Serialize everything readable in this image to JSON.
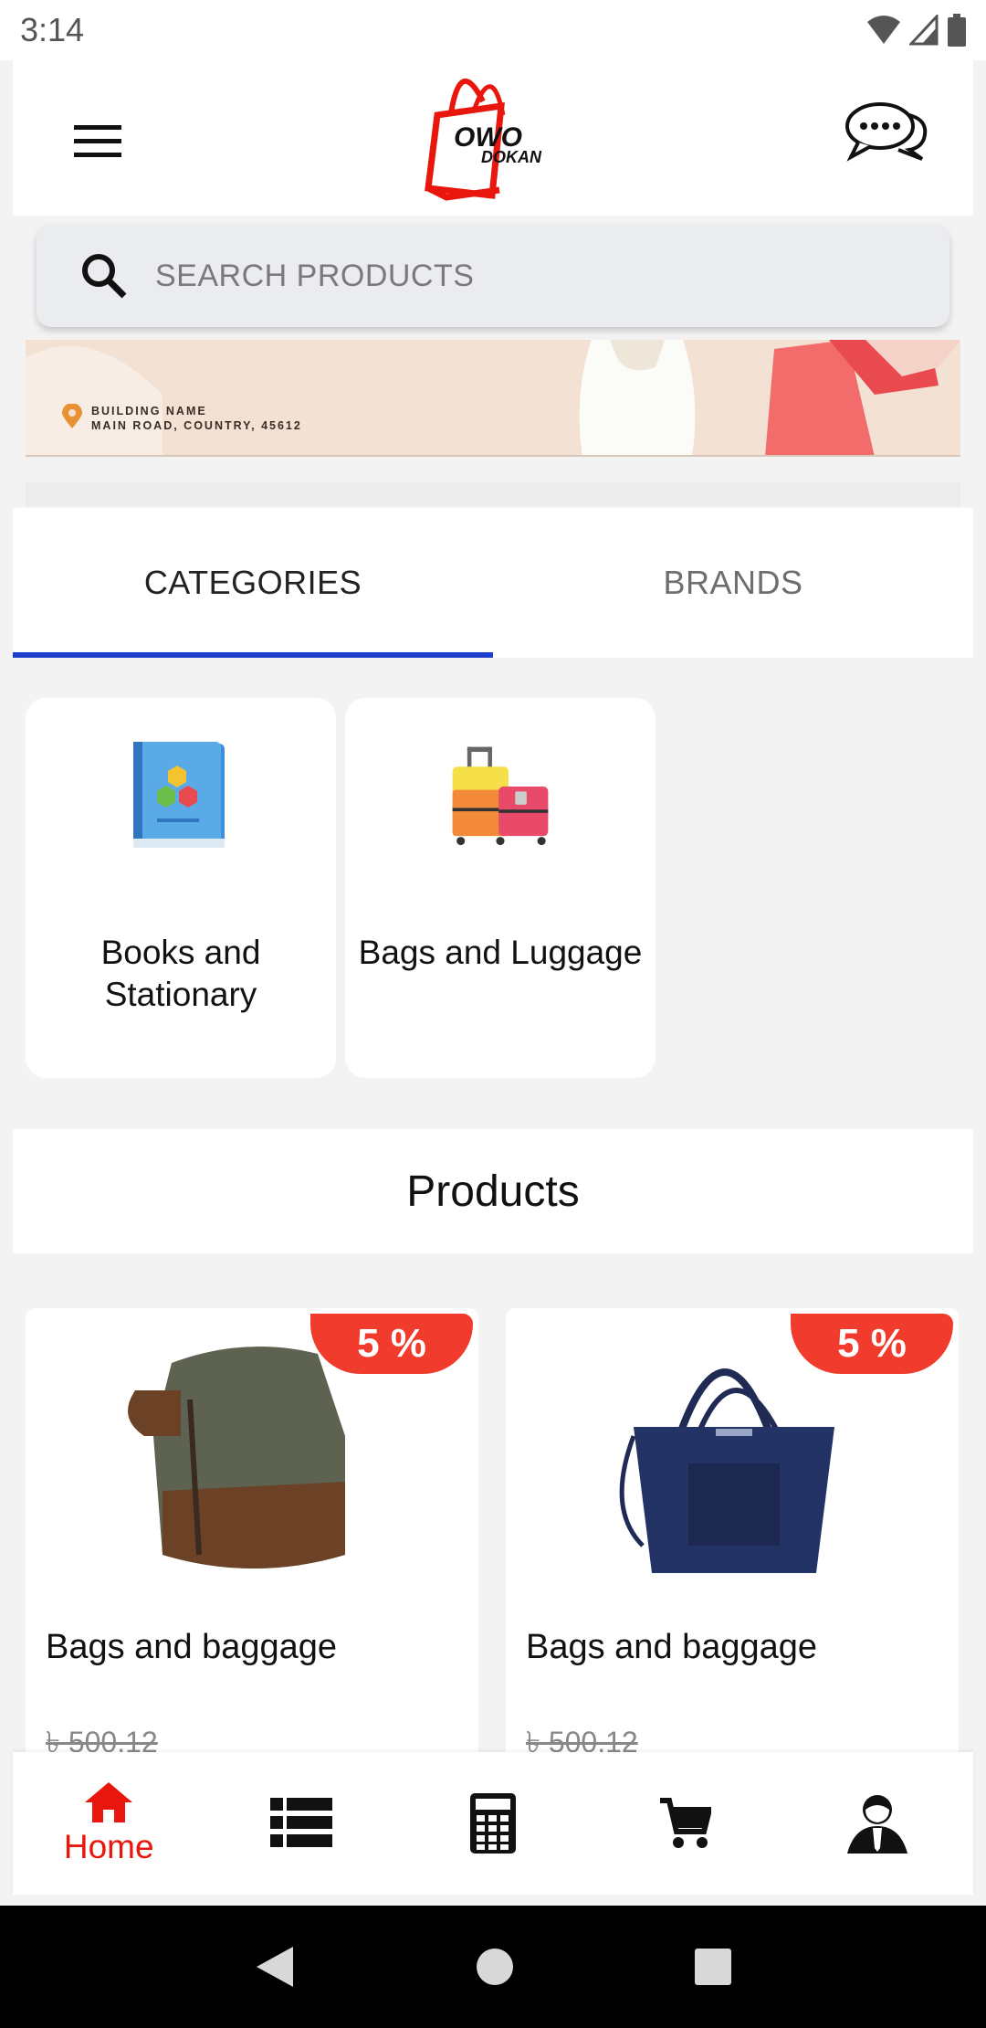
{
  "status_bar": {
    "time": "3:14"
  },
  "header": {
    "logo_line1": "OWO",
    "logo_line2": "DOKAN",
    "menu_icon": "menu-icon",
    "chat_icon": "chat-icon"
  },
  "search": {
    "placeholder": "SEARCH PRODUCTS"
  },
  "banner": {
    "address_line1": "BUILDING NAME",
    "address_line2": "MAIN ROAD, COUNTRY, 45612"
  },
  "tabs": [
    {
      "label": "CATEGORIES",
      "active": true
    },
    {
      "label": "BRANDS",
      "active": false
    }
  ],
  "categories": [
    {
      "label": "Books and Stationary",
      "icon": "book-icon"
    },
    {
      "label": "Bags and Luggage",
      "icon": "luggage-icon"
    }
  ],
  "products_section": {
    "title": "Products"
  },
  "products": [
    {
      "name": "Bags and baggage",
      "discount": "5 %",
      "price": "৳ 500.12",
      "image": "toiletry-bag-image"
    },
    {
      "name": "Bags and baggage",
      "discount": "5 %",
      "price": "৳ 500.12",
      "image": "handbag-image"
    }
  ],
  "bottom_nav": {
    "home_label": "Home",
    "items": [
      "home-icon",
      "list-icon",
      "calculator-icon",
      "cart-icon",
      "profile-icon"
    ]
  },
  "colors": {
    "accent": "#e8160d",
    "tab_indicator": "#1c3fcc",
    "badge": "#f13b2c"
  }
}
